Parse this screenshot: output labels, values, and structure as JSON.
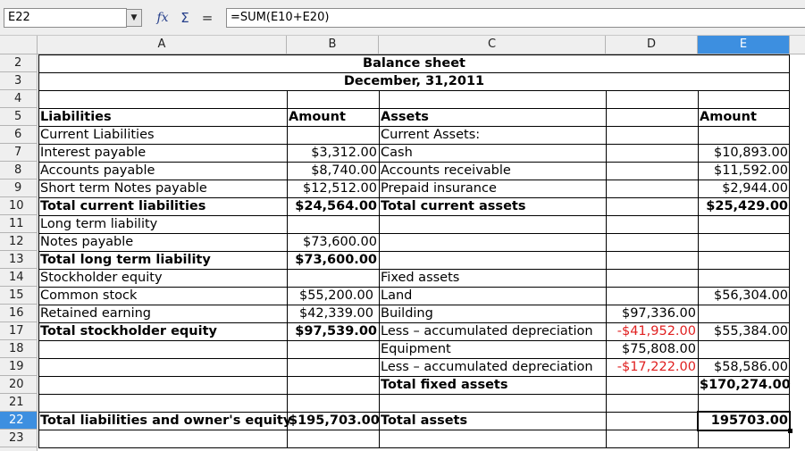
{
  "formula_bar": {
    "name_box": "E22",
    "dropdown_glyph": "▼",
    "function_wizard_glyph": "𝑓x",
    "sum_glyph": "Σ",
    "equals_glyph": "=",
    "formula": "=SUM(E10+E20)"
  },
  "columns": [
    "A",
    "B",
    "C",
    "D",
    "E"
  ],
  "selected_column": "E",
  "rows": [
    "2",
    "3",
    "4",
    "5",
    "6",
    "7",
    "8",
    "9",
    "10",
    "11",
    "12",
    "13",
    "14",
    "15",
    "16",
    "17",
    "18",
    "19",
    "20",
    "21",
    "22",
    "23"
  ],
  "selected_row": "22",
  "cells": {
    "title": "Balance sheet",
    "date": "December, 31,2011",
    "A5": "Liabilities",
    "B5": "Amount",
    "C5": "Assets",
    "E5": "Amount",
    "A6": "Current Liabilities",
    "C6": "Current Assets:",
    "A7": "Interest payable",
    "B7": "$3,312.00",
    "C7": "Cash",
    "E7": "$10,893.00",
    "A8": "Accounts payable",
    "B8": "$8,740.00",
    "C8": "Accounts receivable",
    "E8": "$11,592.00",
    "A9": "Short term Notes payable",
    "B9": "$12,512.00",
    "C9": "Prepaid insurance",
    "E9": "$2,944.00",
    "A10": "Total current liabilities",
    "B10": "$24,564.00",
    "C10": "Total current assets",
    "E10": "$25,429.00",
    "A11": "Long term liability",
    "A12": "Notes payable",
    "B12": "$73,600.00",
    "A13": "Total long term liability",
    "B13": "$73,600.00",
    "A14": "Stockholder equity",
    "C14": "Fixed assets",
    "A15": "Common stock",
    "B15": "$55,200.00",
    "C15": "Land",
    "E15": "$56,304.00",
    "A16": "Retained earning",
    "B16": "$42,339.00",
    "C16": "Building",
    "D16": "$97,336.00",
    "A17": "Total stockholder equity",
    "B17": "$97,539.00",
    "C17": "Less – accumulated depreciation",
    "D17": "-$41,952.00",
    "E17": "$55,384.00",
    "C18": "Equipment",
    "D18": "$75,808.00",
    "C19": "Less – accumulated depreciation",
    "D19": "-$17,222.00",
    "E19": "$58,586.00",
    "C20": "Total fixed assets",
    "E20": "$170,274.00",
    "A22": "Total liabilities and owner's equity",
    "B22": "$195,703.00",
    "C22": "Total assets",
    "E22": "195703.00"
  },
  "colors": {
    "selection_header": "#3d8fe0",
    "negative_value": "#e02020",
    "header_bg": "#efefef"
  }
}
